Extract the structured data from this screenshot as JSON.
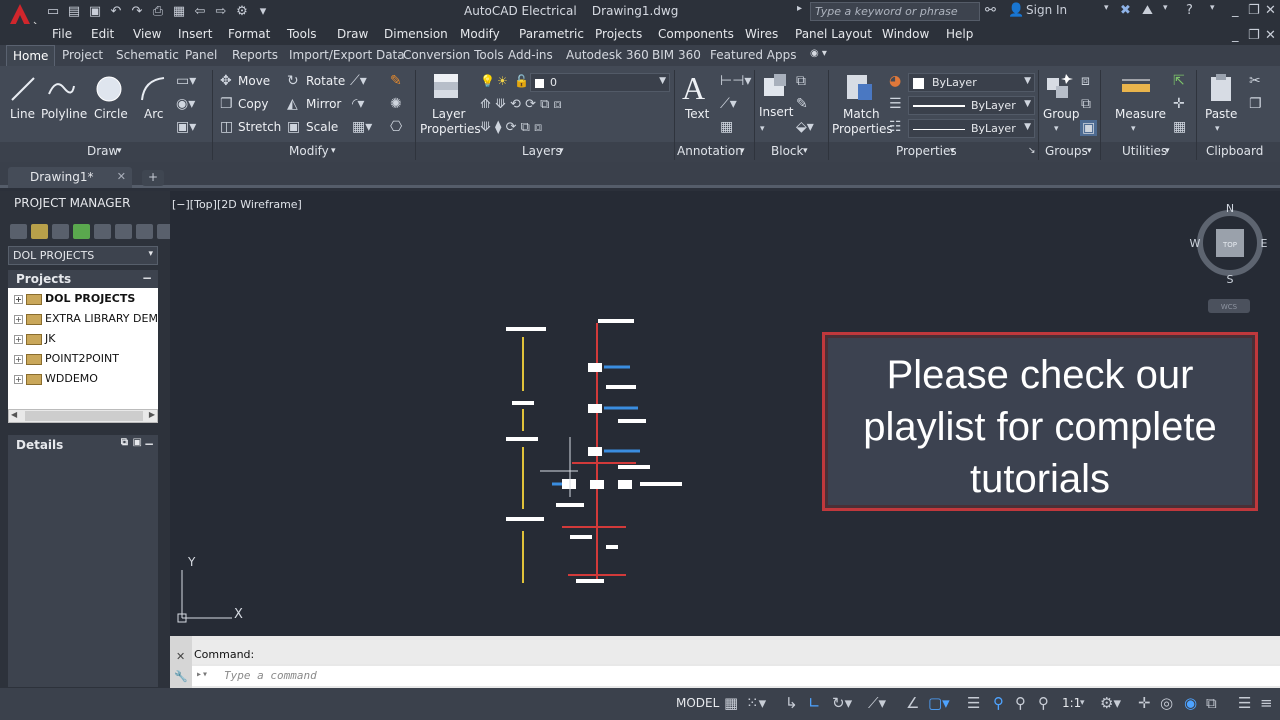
{
  "titlebar": {
    "app_title": "AutoCAD Electrical    Drawing1.dwg",
    "search_placeholder": "Type a keyword or phrase",
    "sign_in": "Sign In"
  },
  "menubar": [
    "File",
    "Edit",
    "View",
    "Insert",
    "Format",
    "Tools",
    "Draw",
    "Dimension",
    "Modify",
    "Parametric",
    "Projects",
    "Components",
    "Wires",
    "Panel Layout",
    "Window",
    "Help"
  ],
  "ribbon_tabs": [
    "Home",
    "Project",
    "Schematic",
    "Panel",
    "Reports",
    "Import/Export Data",
    "Conversion Tools",
    "Add-ins",
    "Autodesk 360",
    "BIM 360",
    "Featured Apps"
  ],
  "ribbon": {
    "draw": {
      "title": "Draw",
      "line": "Line",
      "polyline": "Polyline",
      "circle": "Circle",
      "arc": "Arc"
    },
    "modify": {
      "title": "Modify",
      "move": "Move",
      "rotate": "Rotate",
      "copy": "Copy",
      "mirror": "Mirror",
      "stretch": "Stretch",
      "scale": "Scale"
    },
    "layers": {
      "title": "Layers",
      "layer_props_1": "Layer",
      "layer_props_2": "Properties",
      "current_layer": "0"
    },
    "annotation": {
      "title": "Annotation",
      "text": "Text"
    },
    "block": {
      "title": "Block",
      "insert": "Insert"
    },
    "properties": {
      "title": "Properties",
      "match_1": "Match",
      "match_2": "Properties",
      "color": "ByLayer",
      "linetype": "ByLayer",
      "lineweight": "ByLayer"
    },
    "groups": {
      "title": "Groups",
      "group": "Group"
    },
    "utilities": {
      "title": "Utilities",
      "measure": "Measure"
    },
    "clipboard": {
      "title": "Clipboard",
      "paste": "Paste"
    }
  },
  "doc_tab": "Drawing1*",
  "project_manager": {
    "title": "PROJECT MANAGER",
    "dropdown": "DOL PROJECTS",
    "projects_header": "Projects",
    "items": [
      "DOL PROJECTS",
      "EXTRA LIBRARY DEMO",
      "JK",
      "POINT2POINT",
      "WDDEMO"
    ],
    "details_header": "Details"
  },
  "viewport": {
    "label": "[−][Top][2D Wireframe]",
    "viewcube": {
      "n": "N",
      "s": "S",
      "e": "E",
      "w": "W",
      "top": "TOP",
      "wcs": "WCS"
    },
    "ucs_x": "X",
    "ucs_y": "Y"
  },
  "overlay": {
    "text": "Please check our playlist for complete tutorials"
  },
  "command": {
    "history": "Command:",
    "placeholder": "Type a command"
  },
  "status": {
    "model": "MODEL",
    "scale": "1:1"
  },
  "colors": {
    "overlay_border": "#c0383c",
    "canvas": "#262b35",
    "ribbon": "#434a56"
  }
}
